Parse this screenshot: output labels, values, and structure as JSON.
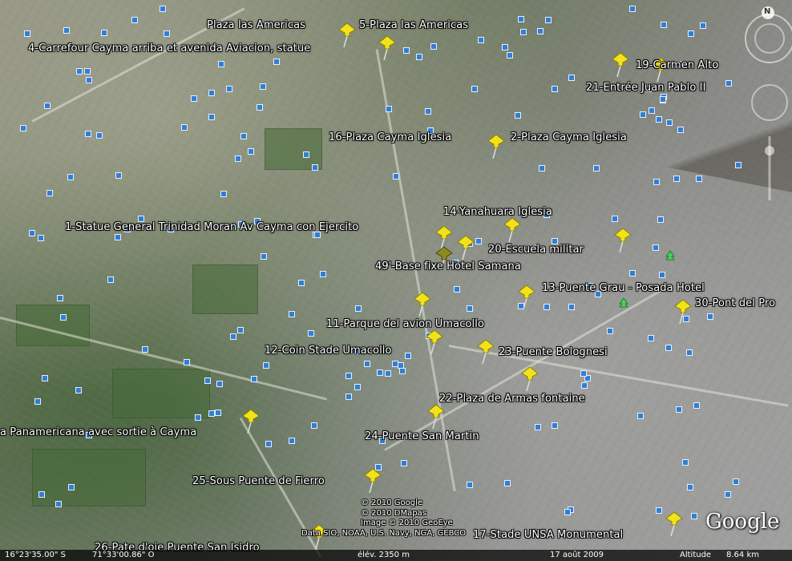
{
  "places": [
    {
      "text": "Plaza las Americas"
    },
    {
      "text": "5-Plaza las Americas"
    },
    {
      "text": "4-Carrefour Cayma arriba et avenida Aviacion, statue"
    },
    {
      "text": "19-Carmen Alto"
    },
    {
      "text": "21-Entrée Juan Pablo II"
    },
    {
      "text": "16-Plaza Cayma Iglesia"
    },
    {
      "text": "2-Plaza Cayma Iglesia"
    },
    {
      "text": "14-Yanahuara Iglesia"
    },
    {
      "text": "1-Statue General Trinidad Moran Av Cayma con Ejercito"
    },
    {
      "text": "20-Escuela militar"
    },
    {
      "text": "49'-Base fixe Hotel Samana"
    },
    {
      "text": "13-Puente Grau - Posada Hotel"
    },
    {
      "text": "30-Pont del Pro"
    },
    {
      "text": "11-Parque del avion Umacollo"
    },
    {
      "text": "12-Coin Stade Umacollo"
    },
    {
      "text": "23-Puente Bolognesi"
    },
    {
      "text": "22-Plaza de Armas fontaine"
    },
    {
      "text": "a Panamericana avec sortie à Cayma"
    },
    {
      "text": "24-Puente San Martin"
    },
    {
      "text": "25-Sous Puente de Fierro"
    },
    {
      "text": "17-Stade UNSA Monumental"
    },
    {
      "text": "26-Pate d'oie Puente San Isidro"
    }
  ],
  "copyright": [
    "© 2010 Google",
    "© 2010 DMapas",
    "Image © 2010 GeoEye",
    "Data SIO, NOAA, U.S. Navy, NGA, GEBCO"
  ],
  "status": {
    "lat": "16°23'35.00\" S",
    "lon": "71°33'00.86\" O",
    "elev": "élév.  2350 m",
    "date": "17 août 2009",
    "alt_label": "Altitude",
    "alt_value": "8.64 km"
  },
  "logo": "Google",
  "compass_letter": "N",
  "colors": {
    "pin": "#f2e21a",
    "marker": "#2f7fd6",
    "label": "#ffffff"
  }
}
